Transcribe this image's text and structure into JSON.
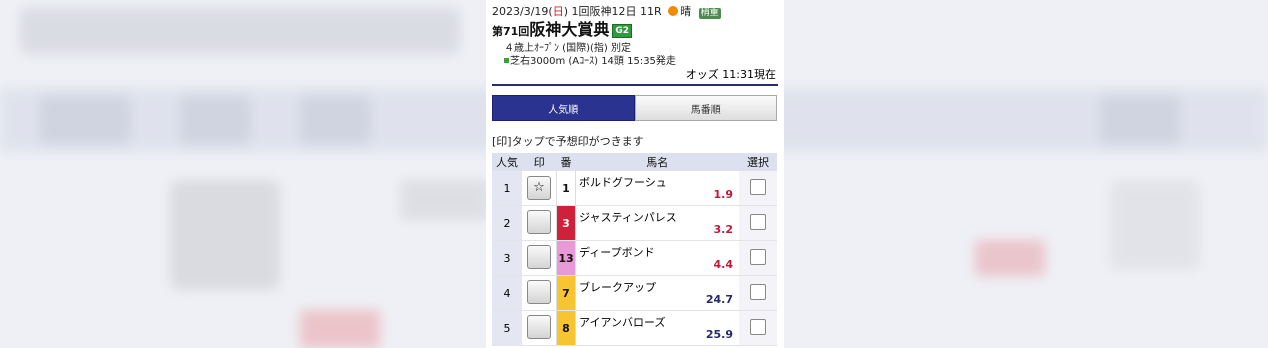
{
  "header": {
    "date_prefix": "2023/3/19(",
    "date_dow": "日",
    "date_suffix": ") 1回阪神12日 11R",
    "weather_label": "晴",
    "track_label": "稍重",
    "race_num_label": "第71回",
    "race_name": "阪神大賞典",
    "grade": "G2",
    "conditions": "４歳上ｵｰﾌﾟﾝ (国際)(指) 別定",
    "course": "芝右3000m (Aｺｰｽ) 14頭 15:35発走",
    "odds_time": "オッズ 11:31現在"
  },
  "tabs": [
    {
      "label": "人気順",
      "active": true
    },
    {
      "label": "馬番順",
      "active": false
    }
  ],
  "hint": "[印]タップで予想印がつきます",
  "table": {
    "headers": {
      "rank": "人気",
      "mark": "印",
      "num": "番",
      "name": "馬名",
      "select": "選択"
    },
    "rows": [
      {
        "rank": "1",
        "mark": "☆",
        "num": "1",
        "name": "ボルドグフーシュ",
        "odds": "1.9",
        "frame_color": "#ffffff",
        "num_color": "#111111",
        "odds_color": "#c0193a"
      },
      {
        "rank": "2",
        "mark": "",
        "num": "3",
        "name": "ジャスティンパレス",
        "odds": "3.2",
        "frame_color": "#d0213a",
        "num_color": "#ffffff",
        "odds_color": "#c0193a"
      },
      {
        "rank": "3",
        "mark": "",
        "num": "13",
        "name": "ディープボンド",
        "odds": "4.4",
        "frame_color": "#e89ad8",
        "num_color": "#111111",
        "odds_color": "#c0193a"
      },
      {
        "rank": "4",
        "mark": "",
        "num": "7",
        "name": "ブレークアップ",
        "odds": "24.7",
        "frame_color": "#f7c531",
        "num_color": "#111111",
        "odds_color": "#2a2a6a"
      },
      {
        "rank": "5",
        "mark": "",
        "num": "8",
        "name": "アイアンバローズ",
        "odds": "25.9",
        "frame_color": "#f7c531",
        "num_color": "#111111",
        "odds_color": "#2a2a6a"
      }
    ]
  }
}
